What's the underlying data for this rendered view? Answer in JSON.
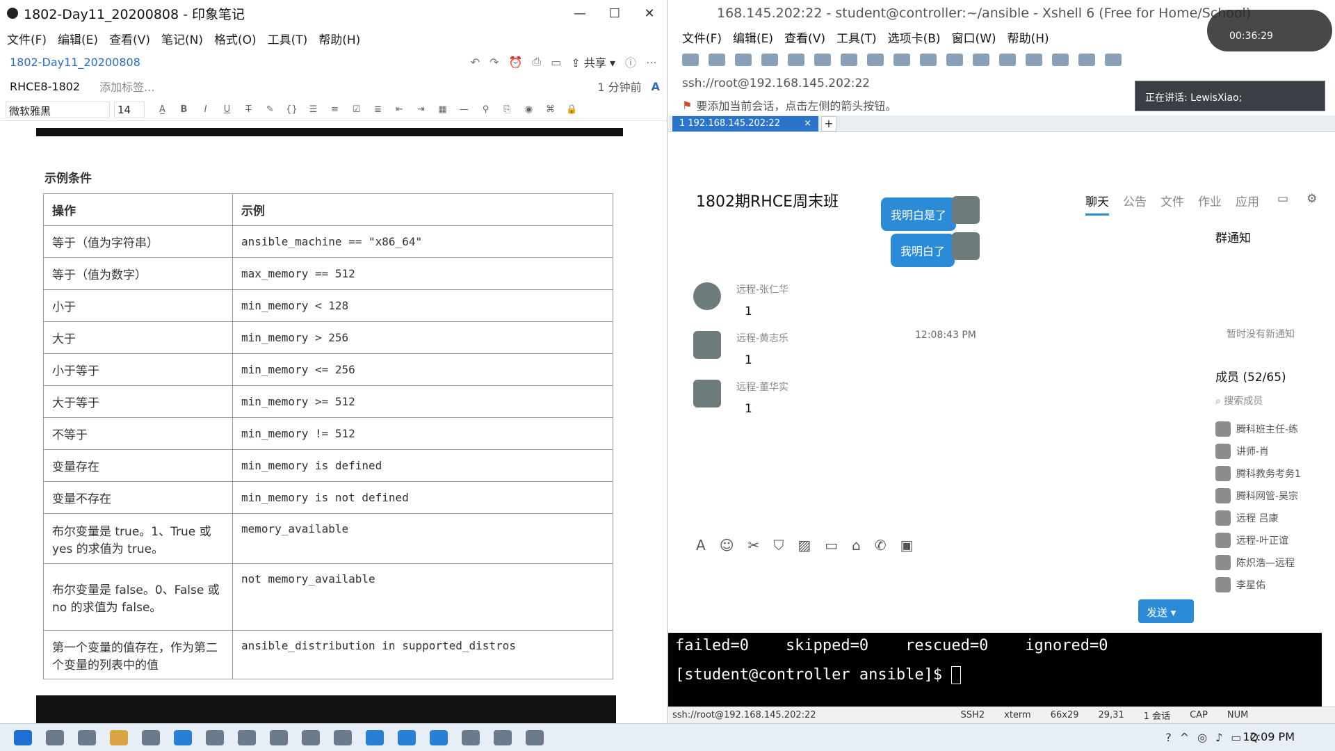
{
  "evernote": {
    "window_title": "1802-Day11_20200808 - 印象笔记",
    "menu": [
      "文件(F)",
      "编辑(E)",
      "查看(V)",
      "笔记(N)",
      "格式(O)",
      "工具(T)",
      "帮助(H)"
    ],
    "note_title": "1802-Day11_20200808",
    "share_label": "共享",
    "notebook": "RHCE8-1802",
    "add_tag": "添加标签...",
    "updated": "1 分钟前",
    "font": "微软雅黑",
    "font_size": "14",
    "section_heading": "示例条件",
    "table": {
      "headers": [
        "操作",
        "示例"
      ],
      "rows": [
        {
          "op": "等于（值为字符串）",
          "ex": "ansible_machine == \"x86_64\""
        },
        {
          "op": "等于（值为数字）",
          "ex": "max_memory == 512"
        },
        {
          "op": "小于",
          "ex": "min_memory < 128"
        },
        {
          "op": "大于",
          "ex": "min_memory > 256"
        },
        {
          "op": "小于等于",
          "ex": "min_memory <= 256"
        },
        {
          "op": "大于等于",
          "ex": "min_memory >= 512"
        },
        {
          "op": "不等于",
          "ex": "min_memory != 512"
        },
        {
          "op": "变量存在",
          "ex": "min_memory is defined"
        },
        {
          "op": "变量不存在",
          "ex": "min_memory is not defined"
        },
        {
          "op": "布尔变量是 true。1、True 或 yes 的求值为 true。",
          "ex": "memory_available"
        },
        {
          "op": "布尔变量是 false。0、False 或 no 的求值为 false。",
          "ex": "not memory_available"
        },
        {
          "op": "第一个变量的值存在，作为第二个变量的列表中的值",
          "ex": "ansible_distribution in supported_distros"
        }
      ]
    }
  },
  "xshell": {
    "window_title": "168.145.202:22 - student@controller:~/ansible - Xshell 6 (Free for Home/School)",
    "menu": [
      "文件(F)",
      "编辑(E)",
      "查看(V)",
      "工具(T)",
      "选项卡(B)",
      "窗口(W)",
      "帮助(H)"
    ],
    "address": "ssh://root@192.168.145.202:22",
    "hint": "要添加当前会话，点击左侧的箭头按钮。",
    "tab_label": "1 192.168.145.202:22",
    "speaking": "正在讲话: LewisXiao;",
    "timer": "00:36:29",
    "terminal_lines": [
      "failed=0    skipped=0    rescued=0    ignored=0",
      "[student@controller ansible]$ "
    ],
    "status": {
      "conn": "ssh://root@192.168.145.202:22",
      "proto": "SSH2",
      "term": "xterm",
      "size": "66x29",
      "pos": "29,31",
      "sessions": "1 会话",
      "caps": "CAP",
      "num": "NUM"
    }
  },
  "chat": {
    "group_title": "1802期RHCE周末班",
    "tabs": [
      "聊天",
      "公告",
      "文件",
      "作业",
      "应用"
    ],
    "my_messages": [
      "我明白是了",
      "我明白了"
    ],
    "timestamp": "12:08:43 PM",
    "messages": [
      {
        "sender": "远程-张仁华",
        "text": "1"
      },
      {
        "sender": "远程-黄志乐",
        "text": "1"
      },
      {
        "sender": "远程-董华实",
        "text": "1"
      }
    ],
    "send_label": "发送",
    "notice_heading": "群通知",
    "notice_empty": "暂时没有新通知",
    "members_heading": "成员 (52/65)",
    "member_search": "搜索成员",
    "members": [
      "腾科班主任-练",
      "讲师-肖",
      "腾科教务考务1",
      "腾科网管-吴宗",
      "远程 吕康",
      "远程-叶正谊",
      "陈炽浩—远程",
      "李星佑"
    ]
  },
  "taskbar": {
    "clock": "12:09 PM"
  }
}
